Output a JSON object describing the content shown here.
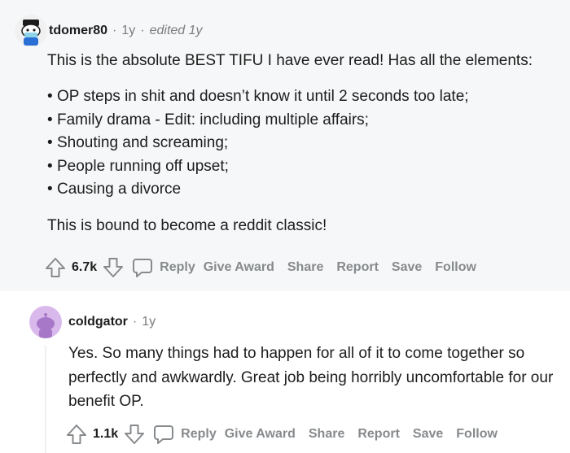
{
  "comments": [
    {
      "author": "tdomer80",
      "age": "1y",
      "edited": "edited 1y",
      "intro": "This is the absolute BEST TIFU I have ever read! Has all the elements:",
      "bullets": [
        "OP steps in shit and doesn’t know it until 2 seconds too late;",
        "Family drama - Edit: including multiple affairs;",
        "Shouting and screaming;",
        "People running off upset;",
        "Causing a divorce"
      ],
      "outro": "This is bound to become a reddit classic!",
      "votes": "6.7k",
      "actions": {
        "reply": "Reply",
        "award": "Give Award",
        "share": "Share",
        "report": "Report",
        "save": "Save",
        "follow": "Follow"
      }
    },
    {
      "author": "coldgator",
      "age": "1y",
      "text": "Yes. So many things had to happen for all of it to come together so perfectly and awkwardly. Great job being horribly uncomfortable for our benefit OP.",
      "votes": "1.1k",
      "actions": {
        "reply": "Reply",
        "award": "Give Award",
        "share": "Share",
        "report": "Report",
        "save": "Save",
        "follow": "Follow"
      }
    }
  ],
  "icons": {
    "upvote": "upvote-arrow-icon",
    "downvote": "downvote-arrow-icon",
    "reply": "speech-bubble-icon"
  },
  "colors": {
    "bg_highlight": "#f6f7f8",
    "muted": "#878a8c",
    "text": "#1c1c1c"
  }
}
